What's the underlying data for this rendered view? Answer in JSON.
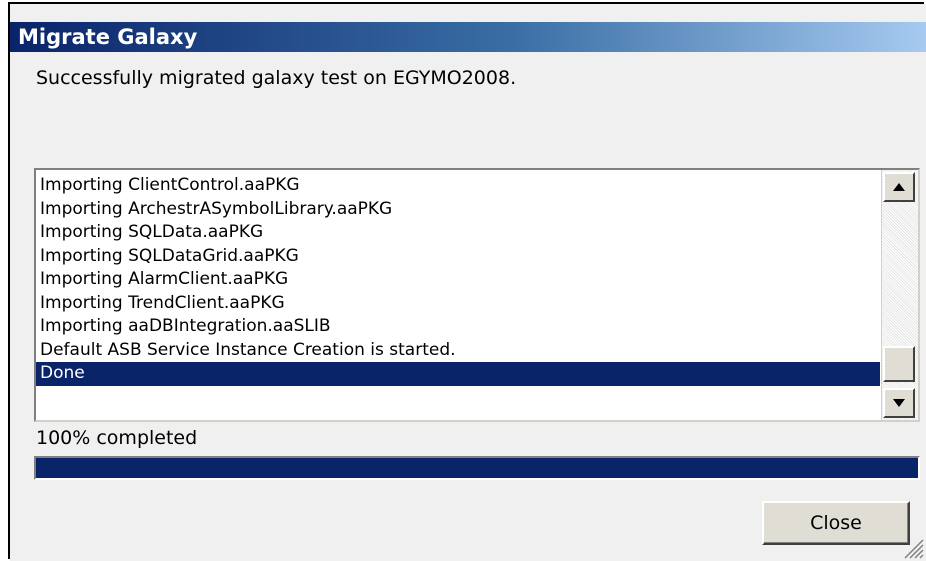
{
  "window": {
    "title": "Migrate Galaxy"
  },
  "message": "Successfully migrated galaxy test on EGYMO2008.",
  "log": {
    "items": [
      "Importing ClientControl.aaPKG",
      "Importing ArchestrASymbolLibrary.aaPKG",
      "Importing SQLData.aaPKG",
      "Importing SQLDataGrid.aaPKG",
      "Importing AlarmClient.aaPKG",
      "Importing TrendClient.aaPKG",
      "Importing aaDBIntegration.aaSLIB",
      "Default ASB Service Instance Creation is started.",
      "Done"
    ],
    "selected_index": 8,
    "scroll_up_icon": "arrow-up-icon",
    "scroll_down_icon": "arrow-down-icon"
  },
  "progress": {
    "label": "100% completed",
    "value": 1.0
  },
  "buttons": {
    "close_label": "Close"
  },
  "colors": {
    "title_start": "#0a246a",
    "title_end": "#a6caf0",
    "selection": "#0a246a",
    "progress_fill": "#0a246a"
  }
}
